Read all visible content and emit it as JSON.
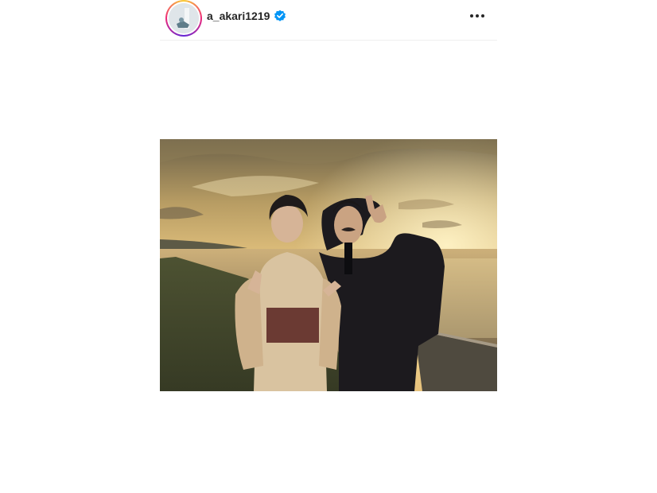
{
  "post": {
    "author": {
      "username": "a_akari1219",
      "verified": true,
      "avatar": "profile-avatar"
    },
    "header_icons": {
      "verified": "verified-badge-icon",
      "more": "more-options-icon"
    },
    "media": {
      "type": "photo",
      "icon": "photo-image"
    }
  },
  "colors": {
    "text": "#262626",
    "verified_blue": "#0095f6",
    "ring_start": "#f9ce34",
    "ring_mid": "#ee2a7b",
    "ring_end": "#6228d7"
  }
}
